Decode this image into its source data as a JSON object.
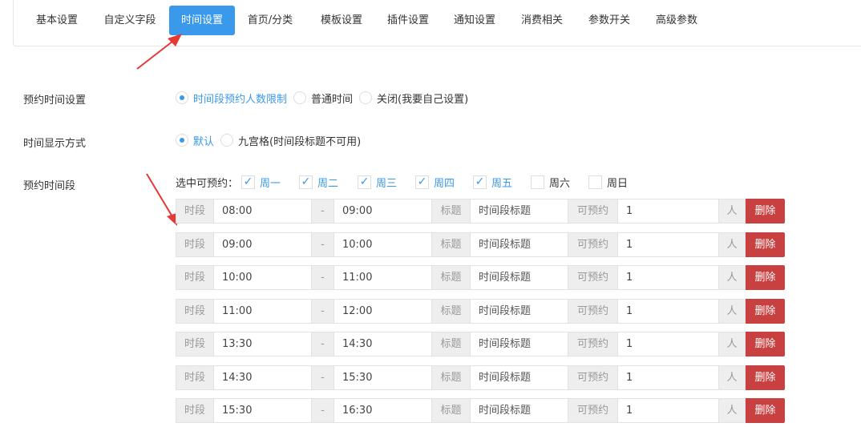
{
  "tabs": [
    {
      "label": "基本设置",
      "active": false
    },
    {
      "label": "自定义字段",
      "active": false
    },
    {
      "label": "时间设置",
      "active": true
    },
    {
      "label": "首页/分类",
      "active": false
    },
    {
      "label": "模板设置",
      "active": false
    },
    {
      "label": "插件设置",
      "active": false
    },
    {
      "label": "通知设置",
      "active": false
    },
    {
      "label": "消费相关",
      "active": false
    },
    {
      "label": "参数开关",
      "active": false
    },
    {
      "label": "高级参数",
      "active": false
    }
  ],
  "booking_time_setting": {
    "label": "预约时间设置",
    "options": [
      {
        "label": "时间段预约人数限制",
        "selected": true
      },
      {
        "label": "普通时间",
        "selected": false
      },
      {
        "label": "关闭(我要自己设置)",
        "selected": false
      }
    ]
  },
  "time_display": {
    "label": "时间显示方式",
    "options": [
      {
        "label": "默认",
        "selected": true
      },
      {
        "label": "九宫格(时间段标题不可用)",
        "selected": false
      }
    ]
  },
  "time_slots": {
    "label": "预约时间段",
    "weekday_prefix": "选中可预约：",
    "weekdays": [
      {
        "label": "周一",
        "checked": true
      },
      {
        "label": "周二",
        "checked": true
      },
      {
        "label": "周三",
        "checked": true
      },
      {
        "label": "周四",
        "checked": true
      },
      {
        "label": "周五",
        "checked": true
      },
      {
        "label": "周六",
        "checked": false
      },
      {
        "label": "周日",
        "checked": false
      }
    ],
    "addon_period": "时段",
    "addon_dash": "-",
    "addon_title": "标题",
    "title_placeholder": "时间段标题",
    "addon_capacity": "可预约",
    "addon_person": "人",
    "delete_label": "删除",
    "check_glyph": "✓",
    "rows": [
      {
        "start": "08:00",
        "end": "09:00",
        "capacity": "1"
      },
      {
        "start": "09:00",
        "end": "10:00",
        "capacity": "1"
      },
      {
        "start": "10:00",
        "end": "11:00",
        "capacity": "1"
      },
      {
        "start": "11:00",
        "end": "12:00",
        "capacity": "1"
      },
      {
        "start": "13:30",
        "end": "14:30",
        "capacity": "1"
      },
      {
        "start": "14:30",
        "end": "15:30",
        "capacity": "1"
      },
      {
        "start": "15:30",
        "end": "16:30",
        "capacity": "1"
      }
    ]
  },
  "colors": {
    "accent": "#3a99ea",
    "danger": "#c94040",
    "annotation_arrow": "#e53935"
  }
}
